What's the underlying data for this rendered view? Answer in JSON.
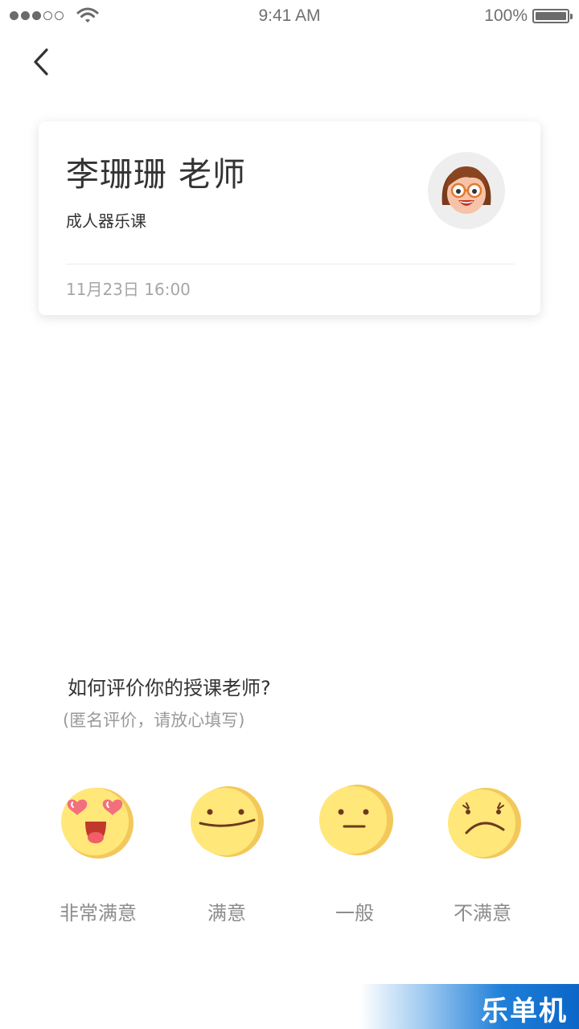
{
  "status_bar": {
    "time": "9:41 AM",
    "battery": "100%"
  },
  "teacher": {
    "name": "李珊珊 老师",
    "course": "成人器乐课",
    "time": "11月23日 16:00"
  },
  "rating": {
    "question": "如何评价你的授课老师?",
    "hint": "(匿名评价，请放心填写)",
    "options": [
      {
        "label": "非常满意",
        "icon": "heart-eyes-face-icon"
      },
      {
        "label": "满意",
        "icon": "smiling-face-icon"
      },
      {
        "label": "一般",
        "icon": "neutral-face-icon"
      },
      {
        "label": "不满意",
        "icon": "frowning-face-icon"
      }
    ]
  },
  "watermark": {
    "text": "乐单机"
  },
  "colors": {
    "emoji_yellow": "#FFE77A",
    "emoji_shade": "#F3C85A",
    "heart": "#F2707E",
    "card_shadow": "#0000001F"
  }
}
